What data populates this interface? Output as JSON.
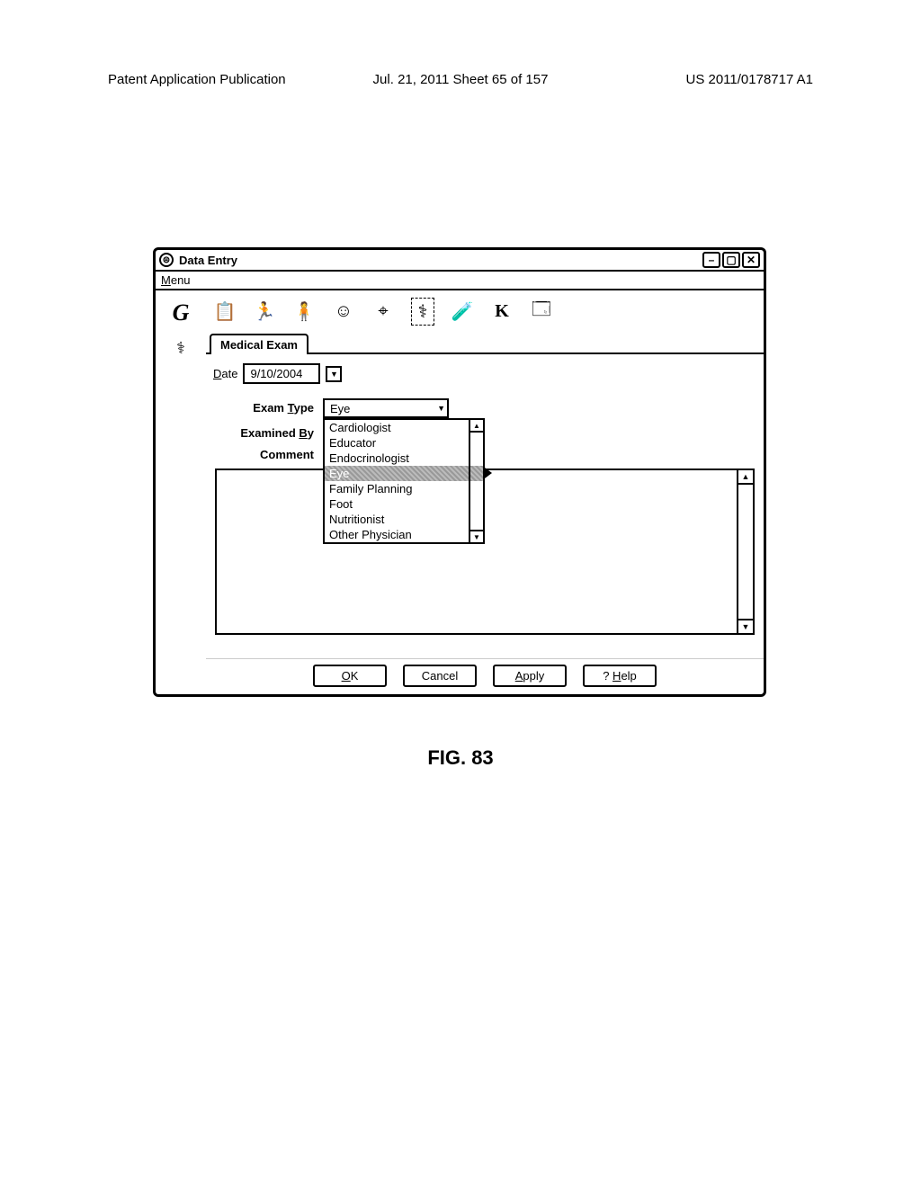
{
  "page_header": {
    "left": "Patent Application Publication",
    "center": "Jul. 21, 2011  Sheet 65 of 157",
    "right": "US 2011/0178717 A1"
  },
  "window": {
    "title": "Data Entry",
    "app_icon_glyph": "⊜",
    "controls": {
      "min": "–",
      "max": "▢",
      "close": "✕"
    }
  },
  "menubar": {
    "menu_label": "Menu",
    "menu_access": "M"
  },
  "left_icons": {
    "g": "G",
    "stethoscope": "⚕"
  },
  "toolbar": {
    "icons": [
      "📋",
      "🏃",
      "🧍",
      "☺",
      "⌖",
      "⚕",
      "🧪",
      "K",
      "🗔"
    ]
  },
  "tab": "Medical Exam",
  "form": {
    "date_label": "Date",
    "date_access": "D",
    "date_value": "9/10/2004",
    "exam_type_label": "Exam Type",
    "exam_type_access": "T",
    "exam_type_value": "Eye",
    "examined_by_label": "Examined By",
    "examined_by_access": "B",
    "comment_label": "Comment",
    "dropdown_options": [
      "Cardiologist",
      "Educator",
      "Endocrinologist",
      "Eye",
      "Family Planning",
      "Foot",
      "Nutritionist",
      "Other Physician"
    ]
  },
  "buttons": {
    "ok": "OK",
    "ok_access": "O",
    "cancel": "Cancel",
    "apply": "Apply",
    "apply_access": "A",
    "help": "? Help",
    "help_access": "H"
  },
  "figure_caption": "FIG. 83"
}
